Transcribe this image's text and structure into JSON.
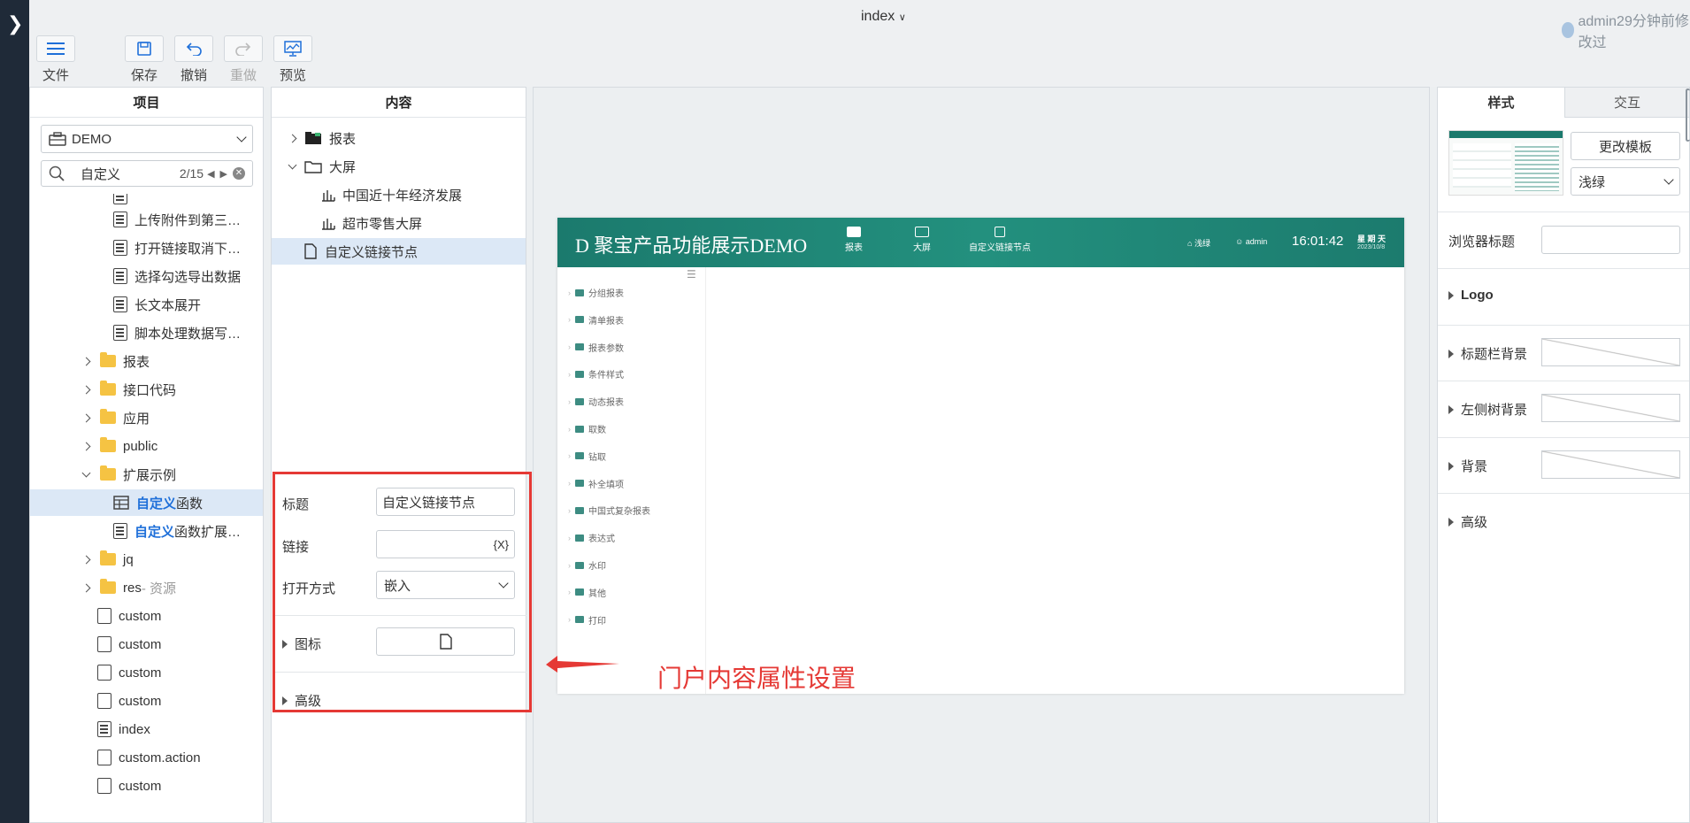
{
  "window": {
    "title": "index",
    "user_status": "admin29分钟前修改过"
  },
  "toolbar": {
    "file": "文件",
    "save": "保存",
    "undo": "撤销",
    "redo": "重做",
    "preview": "预览"
  },
  "project_panel": {
    "header": "项目",
    "project_select": "DEMO",
    "search": {
      "value": "自定义",
      "count": "2/15"
    },
    "tree": [
      {
        "label": "上传附件到第三…",
        "type": "report"
      },
      {
        "label": "打开链接取消下…",
        "type": "report"
      },
      {
        "label": "选择勾选导出数据",
        "type": "report"
      },
      {
        "label": "长文本展开",
        "type": "report"
      },
      {
        "label": "脚本处理数据写…",
        "type": "report"
      },
      {
        "label": "报表",
        "type": "folder"
      },
      {
        "label": "接口代码",
        "type": "folder"
      },
      {
        "label": "应用",
        "type": "folder"
      },
      {
        "label": "public",
        "type": "folder"
      },
      {
        "label": "扩展示例",
        "type": "folder"
      },
      {
        "label_hl": "自定义",
        "label_rest": "函数",
        "type": "table"
      },
      {
        "label_hl": "自定义",
        "label_rest": "函数扩展…",
        "type": "report"
      },
      {
        "label": "jq",
        "type": "folder"
      },
      {
        "label": "res",
        "label_rest": " - 资源",
        "type": "folder"
      },
      {
        "label": "custom",
        "type": "file"
      },
      {
        "label": "custom",
        "type": "file"
      },
      {
        "label": "custom",
        "type": "file"
      },
      {
        "label": "custom",
        "type": "file"
      },
      {
        "label": "index",
        "type": "file"
      },
      {
        "label": "custom.action",
        "type": "file"
      },
      {
        "label": "custom",
        "type": "file"
      }
    ]
  },
  "content_panel": {
    "header": "内容",
    "tree": [
      {
        "label": "报表"
      },
      {
        "label": "大屏"
      },
      {
        "label": "中国近十年经济发展"
      },
      {
        "label": "超市零售大屏"
      },
      {
        "label": "自定义链接节点"
      }
    ],
    "props": {
      "title_label": "标题",
      "title_value": "自定义链接节点",
      "link_label": "链接",
      "link_value": "",
      "link_btn": "{X}",
      "open_label": "打开方式",
      "open_value": "嵌入",
      "icon_label": "图标",
      "advanced_label": "高级"
    }
  },
  "preview": {
    "title": "D 聚宝产品功能展示DEMO",
    "nav": [
      {
        "label": "报表",
        "active": true
      },
      {
        "label": "大屏"
      },
      {
        "label": "自定义链接节点"
      }
    ],
    "theme": "浅绿",
    "user": "admin",
    "time": "16:01:42",
    "weekday": "星 期 天",
    "date": "2023/10/8",
    "side_items": [
      "分组报表",
      "清单报表",
      "报表参数",
      "条件样式",
      "动态报表",
      "取数",
      "钻取",
      "补全填项",
      "中国式复杂报表",
      "表达式",
      "水印",
      "其他",
      "打印"
    ]
  },
  "annotation": {
    "text": "门户内容属性设置",
    "color": "#e53935"
  },
  "props_panel": {
    "tabs": [
      "样式",
      "交互"
    ],
    "change_template": "更改模板",
    "template_select": "浅绿",
    "browser_title_label": "浏览器标题",
    "sections": [
      "Logo",
      "标题栏背景",
      "左侧树背景",
      "背景",
      "高级"
    ]
  },
  "colors": {
    "accent": "#1e6fd9",
    "brand": "#1b7a6d",
    "annotation": "#e53935"
  }
}
